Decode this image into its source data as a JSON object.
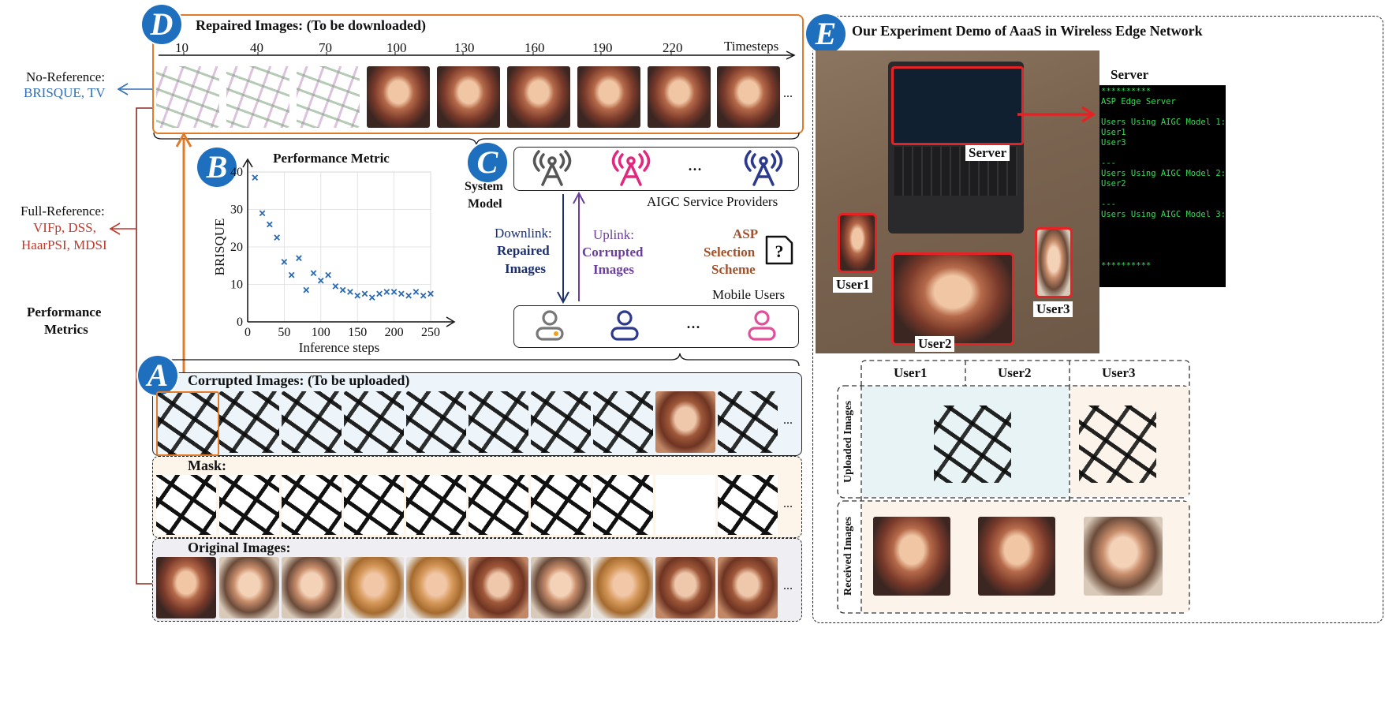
{
  "panel_d": {
    "badge": "D",
    "title": "Repaired Images: (To be downloaded)",
    "axis_label": "Timesteps",
    "timesteps": [
      "10",
      "40",
      "70",
      "100",
      "130",
      "160",
      "190",
      "220"
    ],
    "ellipsis": "..."
  },
  "left": {
    "no_ref_label": "No-Reference:",
    "no_ref_metrics": "BRISQUE, TV",
    "full_ref_label": "Full-Reference:",
    "full_ref_line1": "VIFp, DSS,",
    "full_ref_line2": "HaarPSI, MDSI",
    "perf_line1": "Performance",
    "perf_line2": "Metrics",
    "no_ref_color": "#2f6fb5",
    "full_ref_color": "#c0392b"
  },
  "panel_b": {
    "badge": "B"
  },
  "chart_data": {
    "type": "scatter",
    "title": "Performance Metric",
    "xlabel": "Inference steps",
    "ylabel": "BRISQUE",
    "xlim": [
      0,
      250
    ],
    "ylim": [
      0,
      40
    ],
    "xticks": [
      "0",
      "50",
      "100",
      "150",
      "200",
      "250"
    ],
    "yticks": [
      "0",
      "10",
      "20",
      "30",
      "40"
    ],
    "grid": true,
    "marker": "x",
    "color": "#2a6ab3",
    "x": [
      10,
      20,
      30,
      40,
      50,
      60,
      70,
      80,
      90,
      100,
      110,
      120,
      130,
      140,
      150,
      160,
      170,
      180,
      190,
      200,
      210,
      220,
      230,
      240,
      250
    ],
    "y": [
      38.5,
      29,
      26,
      22.5,
      16,
      12.5,
      17,
      8.5,
      13,
      11,
      12.5,
      9.5,
      8.5,
      8,
      7,
      7.5,
      6.5,
      7.5,
      8,
      8,
      7.5,
      7,
      8,
      7,
      7.5
    ]
  },
  "panel_c": {
    "badge": "C",
    "system_line1": "System",
    "system_line2": "Model",
    "providers_label": "AIGC Service Providers",
    "users_label": "Mobile Users",
    "downlink_line1": "Downlink:",
    "downlink_line2": "Repaired",
    "downlink_line3": "Images",
    "uplink_line1": "Uplink:",
    "uplink_line2": "Corrupted",
    "uplink_line3": "Images",
    "asp_line1": "ASP",
    "asp_line2": "Selection",
    "asp_line3": "Scheme",
    "dots": "...",
    "tower_colors": [
      "#555555",
      "#e0287f",
      "#2d3a8c"
    ],
    "user_colors": [
      "#777777",
      "#2d3a8c",
      "#e04f9a"
    ],
    "downlink_color": "#1c2f6e",
    "uplink_color": "#6a3f99",
    "asp_color": "#a0522d"
  },
  "panel_a": {
    "badge": "A",
    "corrupted_title": "Corrupted Images: (To be uploaded)",
    "mask_title": "Mask:",
    "original_title": "Original Images:",
    "ellipsis": "..."
  },
  "panel_e": {
    "badge": "E",
    "title": "Our Experiment Demo of AaaS in Wireless Edge Network",
    "server_heading": "Server",
    "server_label": "Server",
    "user1_label": "User1",
    "user2_label": "User2",
    "user3_label": "User3",
    "terminal_lines": [
      "**********",
      "ASP Edge Server",
      "",
      "Users Using AIGC Model 1:",
      "User1",
      "User3",
      "",
      "---",
      "Users Using AIGC Model 2:",
      "User2",
      "",
      "---",
      "Users Using AIGC Model 3:",
      "",
      "",
      "",
      "",
      "**********"
    ],
    "terminal_color": "#33dd55",
    "grid_col1": "User1",
    "grid_col2": "User2",
    "grid_col3": "User3",
    "row_uploaded": "Uploaded Images",
    "row_received": "Received Images"
  }
}
